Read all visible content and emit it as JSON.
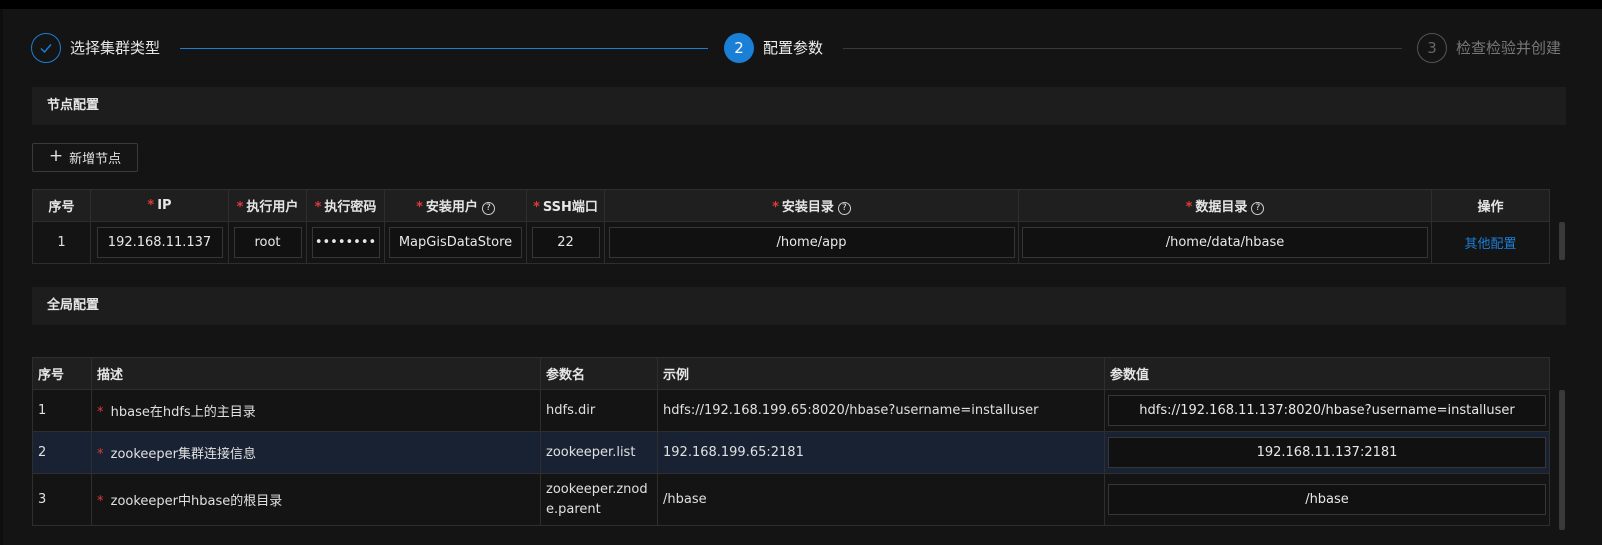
{
  "steps": [
    {
      "label": "选择集群类型",
      "status": "done"
    },
    {
      "number": "2",
      "label": "配置参数",
      "status": "active"
    },
    {
      "number": "3",
      "label": "检查检验并创建",
      "status": "wait"
    }
  ],
  "node_section": {
    "title": "节点配置",
    "add_button": "新增节点",
    "columns": [
      "序号",
      "IP",
      "执行用户",
      "执行密码",
      "安装用户",
      "SSH端口",
      "安装目录",
      "数据目录",
      "操作"
    ],
    "rows": [
      {
        "index": "1",
        "ip": "192.168.11.137",
        "exec_user": "root",
        "exec_password": "••••••••",
        "install_user": "MapGisDataStore",
        "ssh_port": "22",
        "install_dir": "/home/app",
        "data_dir": "/home/data/hbase",
        "action": "其他配置"
      }
    ]
  },
  "global_section": {
    "title": "全局配置",
    "columns": [
      "序号",
      "描述",
      "参数名",
      "示例",
      "参数值"
    ],
    "rows": [
      {
        "index": "1",
        "desc": "hbase在hdfs上的主目录",
        "param": "hdfs.dir",
        "example": "hdfs://192.168.199.65:8020/hbase?username=installuser",
        "value": "hdfs://192.168.11.137:8020/hbase?username=installuser"
      },
      {
        "index": "2",
        "desc": "zookeeper集群连接信息",
        "param": "zookeeper.list",
        "example": "192.168.199.65:2181",
        "value": "192.168.11.137:2181"
      },
      {
        "index": "3",
        "desc": "zookeeper中hbase的根目录",
        "param": "zookeeper.znode.parent",
        "example": "/hbase",
        "value": "/hbase"
      }
    ]
  },
  "colors": {
    "accent": "#1a7fd6",
    "required": "#e03a3a",
    "background": "#141414"
  },
  "icons": {
    "step_done": "check-icon",
    "add": "plus-icon",
    "help": "question-circle-icon"
  }
}
